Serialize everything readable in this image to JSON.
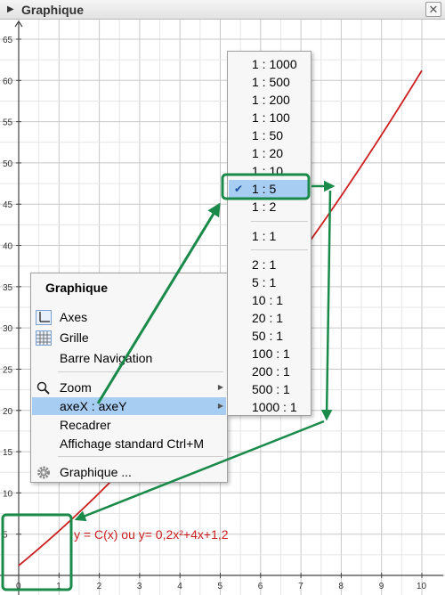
{
  "window": {
    "title": "Graphique",
    "close_symbol": "✕",
    "toggle_symbol": "▶"
  },
  "graph": {
    "x_ticks": [
      "0",
      "1",
      "2",
      "3",
      "4",
      "5",
      "6",
      "7",
      "8",
      "9",
      "10"
    ],
    "y_ticks": [
      "5",
      "10",
      "15",
      "20",
      "25",
      "30",
      "35",
      "40",
      "45",
      "50",
      "55",
      "60",
      "65"
    ],
    "curve_label": "y = C(x) ou y= 0,2x²+4x+1,2",
    "curve_color": "#cc1f1f",
    "function": {
      "a": 0.2,
      "b": 4,
      "c": 1.2,
      "x_range": [
        0,
        10
      ]
    },
    "x_range": [
      0,
      10
    ],
    "y_range": [
      0,
      65
    ]
  },
  "context_menu": {
    "title": "Graphique",
    "items": [
      {
        "label": "Axes",
        "icon": "axes-icon"
      },
      {
        "label": "Grille",
        "icon": "grid-icon"
      },
      {
        "label": "Barre Navigation",
        "icon": ""
      },
      {
        "label": "Zoom",
        "icon": "magnifier-icon",
        "submenu": true
      },
      {
        "label": "axeX : axeY",
        "icon": "",
        "submenu": true,
        "selected": true
      },
      {
        "label": "Recadrer",
        "icon": ""
      },
      {
        "label": "Affichage standard Ctrl+M",
        "icon": ""
      },
      {
        "label": "Graphique ...",
        "icon": "gear-icon"
      }
    ],
    "submenu_arrow": "▶"
  },
  "ratio_submenu": {
    "group1": [
      "1 : 1000",
      "1 : 500",
      "1 : 200",
      "1 : 100",
      "1 : 50",
      "1 : 20",
      "1 : 10",
      "1 : 5",
      "1 : 2"
    ],
    "group2": [
      "1 : 1"
    ],
    "group3": [
      "2 : 1",
      "5 : 1",
      "10 : 1",
      "20 : 1",
      "50 : 1",
      "100 : 1",
      "200 : 1",
      "500 : 1",
      "1000 : 1"
    ],
    "selected": "1 : 5",
    "check_symbol": "✔"
  },
  "annotation_color": "#1a8a4a"
}
